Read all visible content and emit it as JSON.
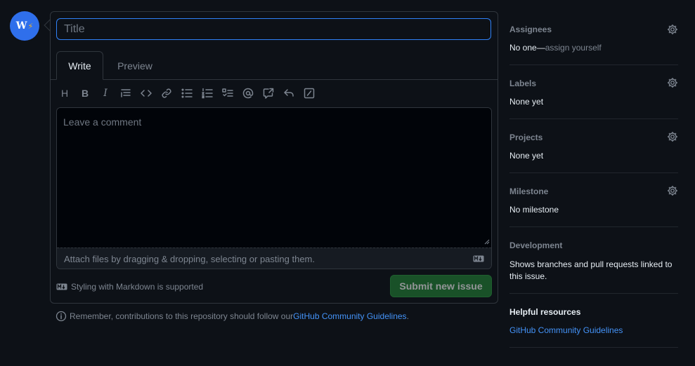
{
  "avatar": {
    "initial": "W",
    "badge": "⚡"
  },
  "issue_form": {
    "title_placeholder": "Title",
    "tabs": [
      {
        "label": "Write",
        "active": true
      },
      {
        "label": "Preview",
        "active": false
      }
    ],
    "toolbar_icons": [
      "heading-icon",
      "bold-icon",
      "italic-icon",
      "quote-icon",
      "code-icon",
      "link-icon",
      "unordered-list-icon",
      "ordered-list-icon",
      "task-list-icon",
      "mention-icon",
      "cross-reference-icon",
      "reply-icon",
      "slash-commands-icon"
    ],
    "toolbar_text": {
      "heading": "H",
      "bold": "B",
      "italic": "I"
    },
    "comment_placeholder": "Leave a comment",
    "attach_text": "Attach files by dragging & dropping, selecting or pasting them.",
    "markdown_note": "Styling with Markdown is supported",
    "submit_label": "Submit new issue",
    "remember_prefix": "Remember, contributions to this repository should follow our ",
    "remember_link": "GitHub Community Guidelines",
    "remember_suffix": "."
  },
  "sidebar": {
    "assignees": {
      "heading": "Assignees",
      "value": "No one—",
      "action": "assign yourself"
    },
    "labels": {
      "heading": "Labels",
      "value": "None yet"
    },
    "projects": {
      "heading": "Projects",
      "value": "None yet"
    },
    "milestone": {
      "heading": "Milestone",
      "value": "No milestone"
    },
    "development": {
      "heading": "Development",
      "value": "Shows branches and pull requests linked to this issue."
    },
    "helpful": {
      "heading": "Helpful resources",
      "link": "GitHub Community Guidelines"
    }
  },
  "colors": {
    "accent": "#2f81f7",
    "link": "#4493f8",
    "submit_bg": "#238636",
    "background": "#0d1117"
  }
}
